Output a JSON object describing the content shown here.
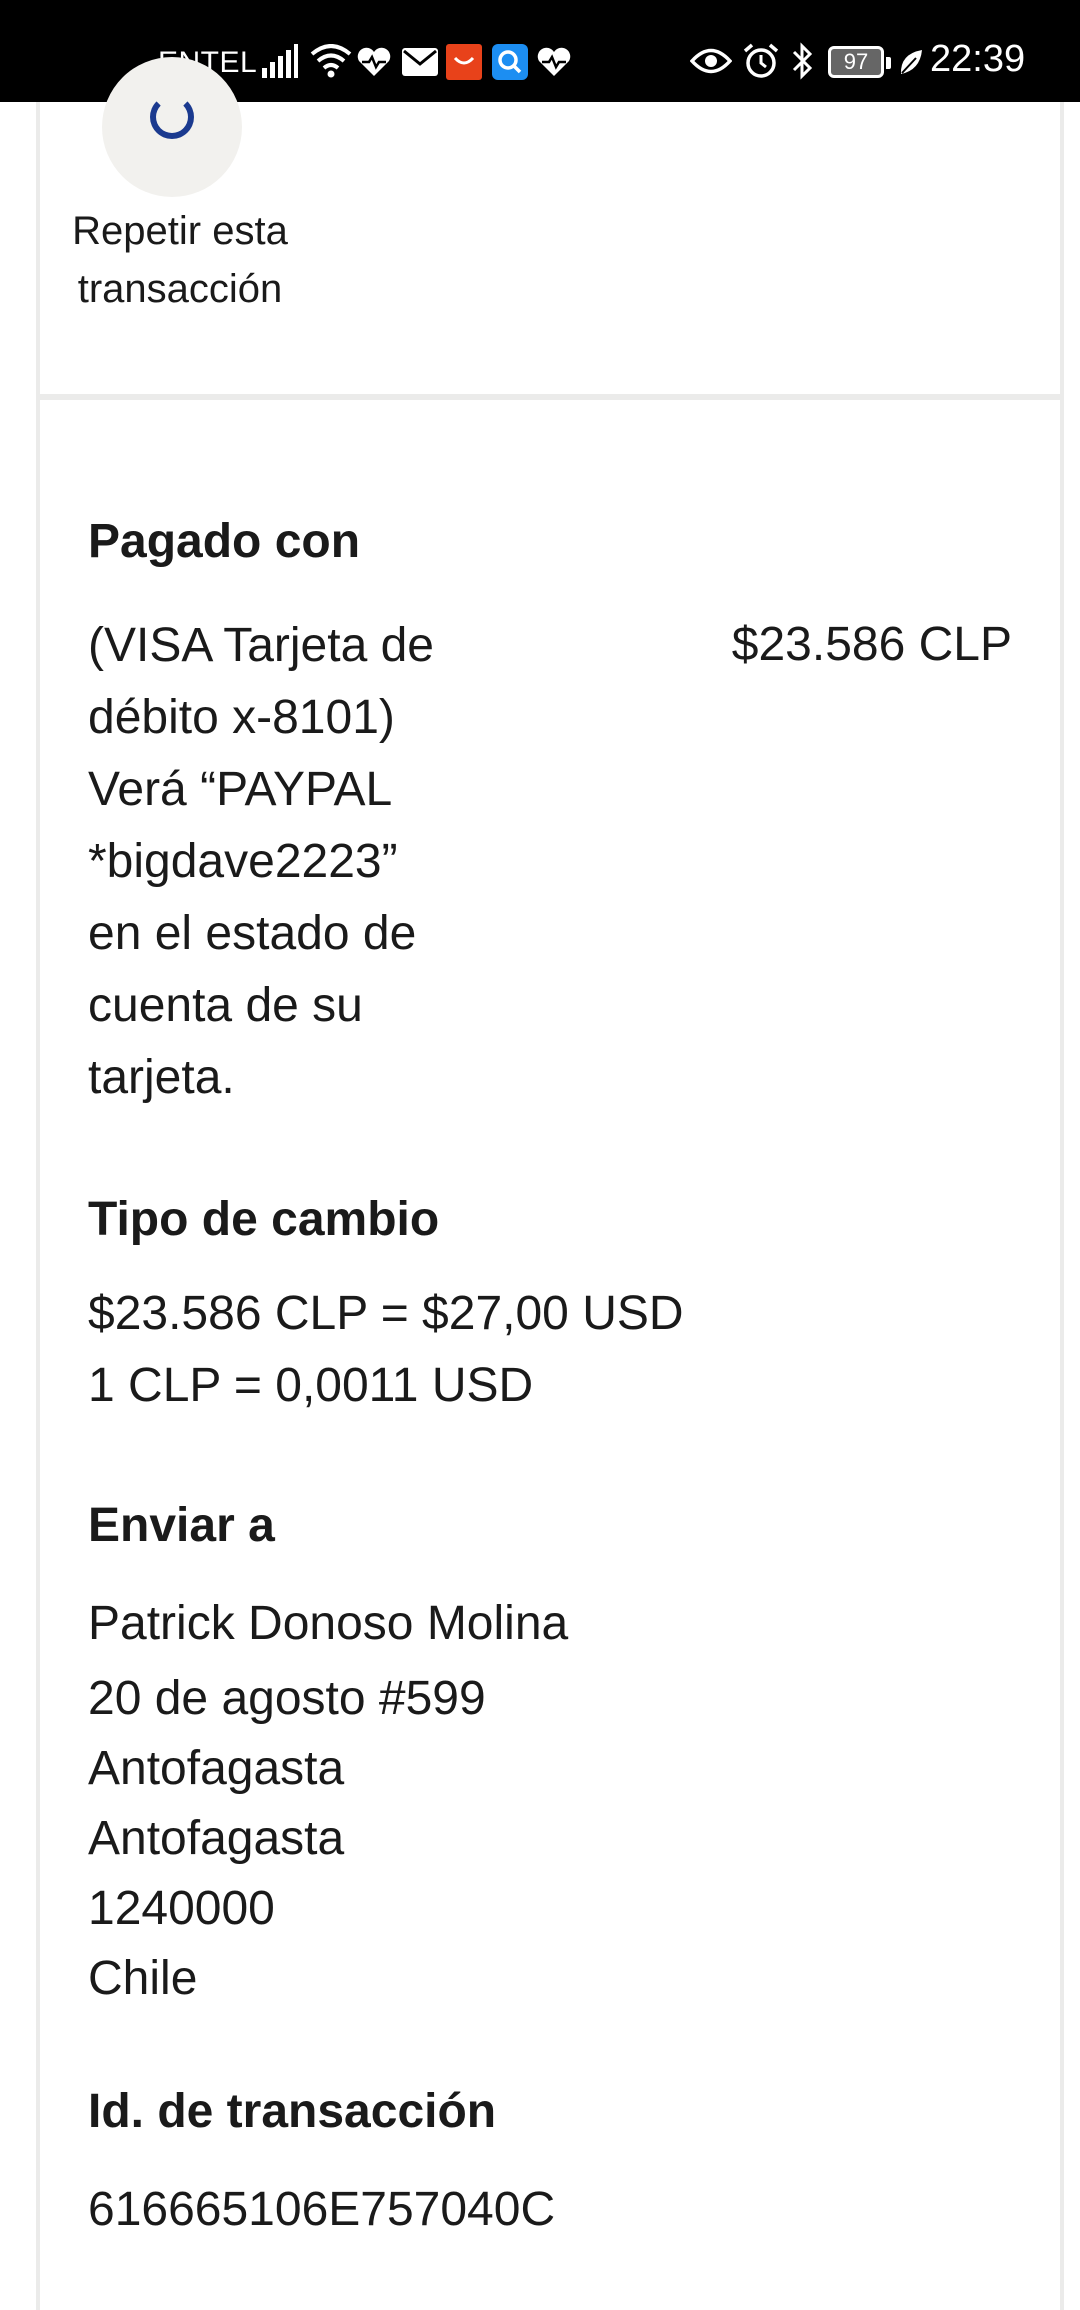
{
  "status_bar": {
    "carrier": "ENTEL",
    "battery": "97",
    "time": "22:39"
  },
  "repeat_transaction": {
    "label": "Repetir esta\ntransacción"
  },
  "paid_with": {
    "heading": "Pagado con",
    "method": "(VISA Tarjeta de\ndébito x-8101)\nVerá “PAYPAL\n*bigdave2223”\nen el estado de\ncuenta de su\ntarjeta.",
    "amount": "$23.586 CLP"
  },
  "exchange_rate": {
    "heading": "Tipo de cambio",
    "line1": "$23.586 CLP = $27,00 USD",
    "line2": "1 CLP = 0,0011 USD"
  },
  "ship_to": {
    "heading": "Enviar a",
    "name": "Patrick Donoso Molina",
    "address": "20 de agosto #599\nAntofagasta\nAntofagasta\n1240000\nChile"
  },
  "transaction_id": {
    "heading": "Id. de transacción",
    "value": "616665106E757040C"
  },
  "colors": {
    "status_bar_bg": "#000000",
    "text": "#1a1a1a",
    "accent_icon": "#1b3a8f",
    "divider": "#ebebea"
  }
}
